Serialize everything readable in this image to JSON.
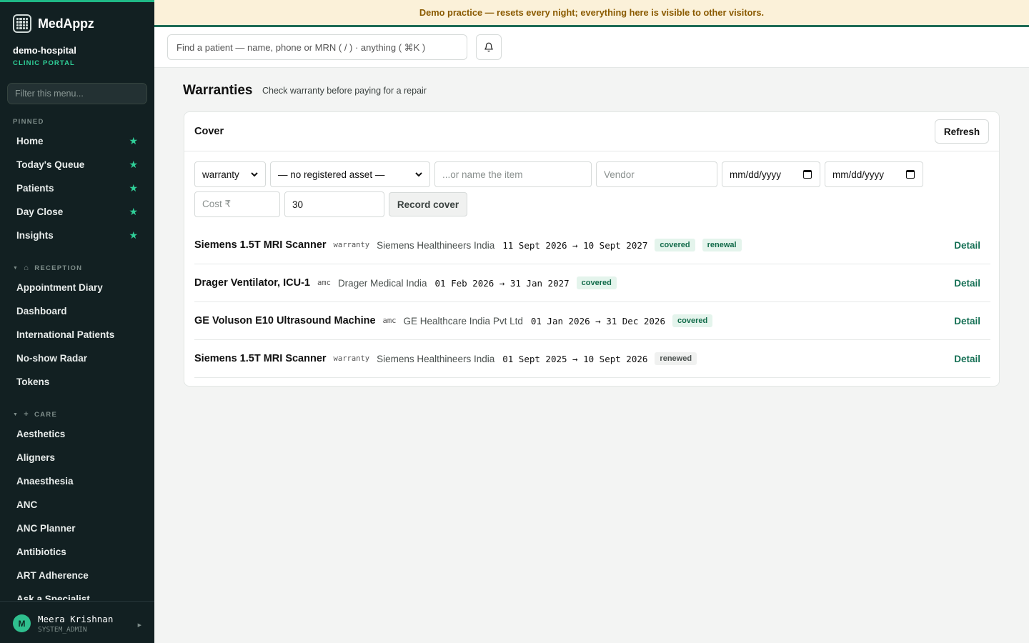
{
  "app": {
    "name": "MedAppz",
    "org": "demo-hospital",
    "org_sub": "CLINIC PORTAL"
  },
  "sidebar": {
    "filter_placeholder": "Filter this menu...",
    "pinned_label": "PINNED",
    "pinned": [
      {
        "label": "Home"
      },
      {
        "label": "Today's Queue"
      },
      {
        "label": "Patients"
      },
      {
        "label": "Day Close"
      },
      {
        "label": "Insights"
      }
    ],
    "reception_label": "RECEPTION",
    "reception": [
      {
        "label": "Appointment Diary"
      },
      {
        "label": "Dashboard"
      },
      {
        "label": "International Patients"
      },
      {
        "label": "No-show Radar"
      },
      {
        "label": "Tokens"
      }
    ],
    "care_label": "CARE",
    "care": [
      {
        "label": "Aesthetics"
      },
      {
        "label": "Aligners"
      },
      {
        "label": "Anaesthesia"
      },
      {
        "label": "ANC"
      },
      {
        "label": "ANC Planner"
      },
      {
        "label": "Antibiotics"
      },
      {
        "label": "ART Adherence"
      },
      {
        "label": "Ask a Specialist"
      }
    ],
    "user": {
      "initial": "M",
      "name": "Meera Krishnan",
      "role": "SYSTEM_ADMIN"
    }
  },
  "banner": "Demo practice — resets every night; everything here is visible to other visitors.",
  "topbar": {
    "search_placeholder": "Find a patient — name, phone or MRN ( / ) · anything ( ⌘K )"
  },
  "page": {
    "title": "Warranties",
    "subtitle": "Check warranty before paying for a repair"
  },
  "card": {
    "title": "Cover",
    "refresh_label": "Refresh",
    "form": {
      "type_value": "warranty",
      "asset_value": "— no registered asset —",
      "item_placeholder": "...or name the item",
      "vendor_placeholder": "Vendor",
      "start_date": "mm/dd/yyyy",
      "end_date": "mm/dd/yyyy",
      "cost_placeholder": "Cost ₹",
      "days_value": "30",
      "record_label": "Record cover"
    },
    "rows": [
      {
        "name": "Siemens 1.5T MRI Scanner",
        "type": "warranty",
        "vendor": "Siemens Healthineers India",
        "dates": "11 Sept 2026 → 10 Sept 2027",
        "badges": [
          "covered",
          "renewal"
        ],
        "detail": "Detail"
      },
      {
        "name": "Drager Ventilator, ICU-1",
        "type": "amc",
        "vendor": "Drager Medical India",
        "dates": "01 Feb 2026 → 31 Jan 2027",
        "badges": [
          "covered"
        ],
        "detail": "Detail"
      },
      {
        "name": "GE Voluson E10 Ultrasound Machine",
        "type": "amc",
        "vendor": "GE Healthcare India Pvt Ltd",
        "dates": "01 Jan 2026 → 31 Dec 2026",
        "badges": [
          "covered"
        ],
        "detail": "Detail"
      },
      {
        "name": "Siemens 1.5T MRI Scanner",
        "type": "warranty",
        "vendor": "Siemens Healthineers India",
        "dates": "01 Sept 2025 → 10 Sept 2026",
        "badges": [
          "renewed"
        ],
        "detail": "Detail"
      }
    ]
  },
  "colors": {
    "accent": "#1fb987",
    "sidebar_bg": "#122022",
    "link": "#167055",
    "banner_bg": "#fbf1d9"
  }
}
